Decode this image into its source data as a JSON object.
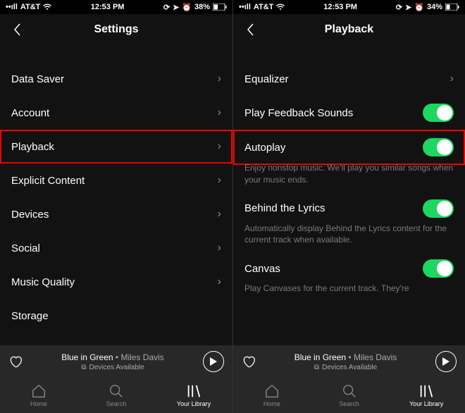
{
  "left": {
    "status": {
      "carrier": "AT&T",
      "time": "12:53 PM",
      "battery": "38%"
    },
    "title": "Settings",
    "items": [
      {
        "label": "Data Saver"
      },
      {
        "label": "Account"
      },
      {
        "label": "Playback",
        "highlight": true
      },
      {
        "label": "Explicit Content"
      },
      {
        "label": "Devices"
      },
      {
        "label": "Social"
      },
      {
        "label": "Music Quality"
      },
      {
        "label": "Storage"
      }
    ]
  },
  "right": {
    "status": {
      "carrier": "AT&T",
      "time": "12:53 PM",
      "battery": "34%"
    },
    "title": "Playback",
    "items": [
      {
        "label": "Equalizer",
        "type": "link"
      },
      {
        "label": "Play Feedback Sounds",
        "type": "toggle",
        "on": true
      },
      {
        "label": "Autoplay",
        "type": "toggle",
        "on": true,
        "highlight": true,
        "desc": "Enjoy nonstop music. We'll play you similar songs when your music ends."
      },
      {
        "label": "Behind the Lyrics",
        "type": "toggle",
        "on": true,
        "desc": "Automatically display Behind the Lyrics content for the current track when available."
      },
      {
        "label": "Canvas",
        "type": "toggle",
        "on": true,
        "desc": "Play Canvases for the current track. They're"
      }
    ]
  },
  "nowplaying": {
    "track": "Blue in Green",
    "artist": "Miles Davis",
    "devices": "Devices Available"
  },
  "tabs": {
    "home": "Home",
    "search": "Search",
    "library": "Your Library"
  }
}
